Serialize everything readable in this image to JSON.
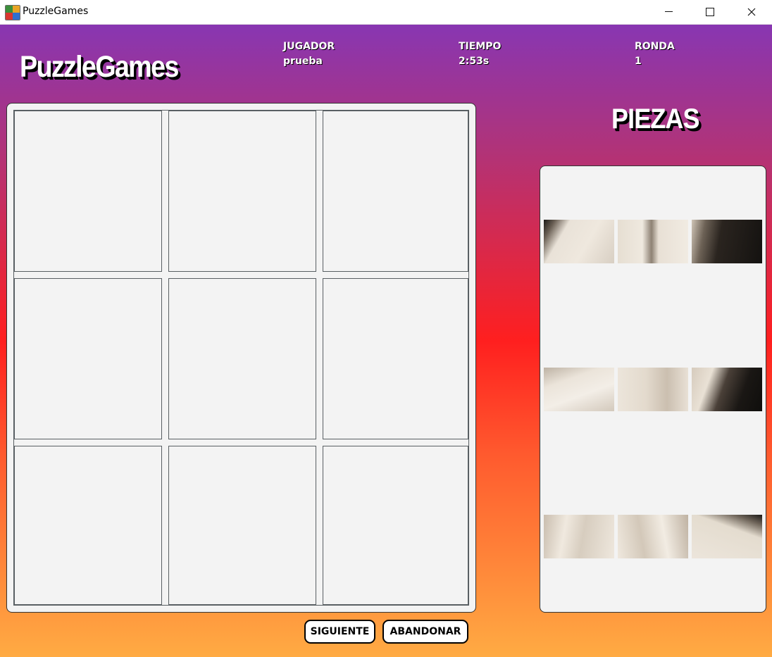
{
  "window": {
    "title": "PuzzleGames",
    "minimize_icon": "minimize-icon",
    "maximize_icon": "maximize-icon",
    "close_icon": "close-icon"
  },
  "header": {
    "logo": "PuzzleGames",
    "player": {
      "label": "JUGADOR",
      "value": "prueba"
    },
    "time": {
      "label": "TIEMPO",
      "value": "2:53s"
    },
    "round": {
      "label": "RONDA",
      "value": "1"
    }
  },
  "board": {
    "rows": 3,
    "cols": 3,
    "cells": [
      "empty",
      "empty",
      "empty",
      "empty",
      "empty",
      "empty",
      "empty",
      "empty",
      "empty"
    ]
  },
  "pieces_panel": {
    "title": "PIEZAS",
    "pieces": [
      {
        "id": "piece-1"
      },
      {
        "id": "piece-2"
      },
      {
        "id": "piece-3"
      },
      {
        "id": "piece-4"
      },
      {
        "id": "piece-5"
      },
      {
        "id": "piece-6"
      },
      {
        "id": "piece-7"
      },
      {
        "id": "piece-8"
      },
      {
        "id": "piece-9"
      }
    ]
  },
  "buttons": {
    "next": "SIGUIENTE",
    "abandon": "ABANDONAR"
  },
  "colors": {
    "gradient_top": "#8836b2",
    "gradient_mid": "#ff1f1f",
    "gradient_bottom": "#ffab43",
    "panel": "#f3f3f3"
  }
}
